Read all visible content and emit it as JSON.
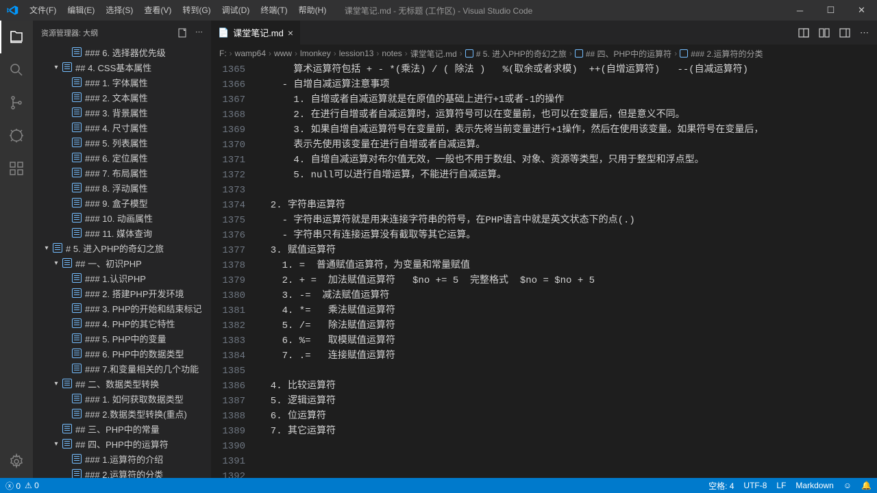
{
  "title": "课堂笔记.md - 无标题 (工作区) - Visual Studio Code",
  "menu": [
    "文件(F)",
    "编辑(E)",
    "选择(S)",
    "查看(V)",
    "转到(G)",
    "调试(D)",
    "终端(T)",
    "帮助(H)"
  ],
  "sidebar": {
    "title": "资源管理器: 大纲",
    "tree": [
      {
        "indent": 2,
        "chev": "",
        "label": "### 6. 选择器优先级"
      },
      {
        "indent": 1,
        "chev": "▾",
        "label": "## 4. CSS基本属性"
      },
      {
        "indent": 2,
        "chev": "",
        "label": "### 1. 字体属性"
      },
      {
        "indent": 2,
        "chev": "",
        "label": "### 2. 文本属性"
      },
      {
        "indent": 2,
        "chev": "",
        "label": "### 3. 背景属性"
      },
      {
        "indent": 2,
        "chev": "",
        "label": "### 4. 尺寸属性"
      },
      {
        "indent": 2,
        "chev": "",
        "label": "### 5. 列表属性"
      },
      {
        "indent": 2,
        "chev": "",
        "label": "### 6. 定位属性"
      },
      {
        "indent": 2,
        "chev": "",
        "label": "### 7. 布局属性"
      },
      {
        "indent": 2,
        "chev": "",
        "label": "### 8. 浮动属性"
      },
      {
        "indent": 2,
        "chev": "",
        "label": "### 9. 盒子模型"
      },
      {
        "indent": 2,
        "chev": "",
        "label": "### 10. 动画属性"
      },
      {
        "indent": 2,
        "chev": "",
        "label": "### 11. 媒体查询"
      },
      {
        "indent": 0,
        "chev": "▾",
        "label": "# 5. 进入PHP的奇幻之旅"
      },
      {
        "indent": 1,
        "chev": "▾",
        "label": "## 一、初识PHP"
      },
      {
        "indent": 2,
        "chev": "",
        "label": "### 1.认识PHP"
      },
      {
        "indent": 2,
        "chev": "",
        "label": "### 2. 搭建PHP开发环境"
      },
      {
        "indent": 2,
        "chev": "",
        "label": "### 3. PHP的开始和结束标记"
      },
      {
        "indent": 2,
        "chev": "",
        "label": "### 4. PHP的其它特性"
      },
      {
        "indent": 2,
        "chev": "",
        "label": "### 5. PHP中的变量"
      },
      {
        "indent": 2,
        "chev": "",
        "label": "### 6. PHP中的数据类型"
      },
      {
        "indent": 2,
        "chev": "",
        "label": "### 7.和变量相关的几个功能"
      },
      {
        "indent": 1,
        "chev": "▾",
        "label": "## 二、数据类型转换"
      },
      {
        "indent": 2,
        "chev": "",
        "label": "### 1. 如何获取数据类型"
      },
      {
        "indent": 2,
        "chev": "",
        "label": "### 2.数据类型转换(重点)"
      },
      {
        "indent": 1,
        "chev": "",
        "label": "## 三、PHP中的常量"
      },
      {
        "indent": 1,
        "chev": "▾",
        "label": "## 四、PHP中的运算符"
      },
      {
        "indent": 2,
        "chev": "",
        "label": "### 1.运算符的介绍"
      },
      {
        "indent": 2,
        "chev": "",
        "label": "### 2.运算符的分类"
      }
    ]
  },
  "tab": {
    "name": "课堂笔记.md"
  },
  "breadcrumbs": [
    "F:",
    "wamp64",
    "www",
    "lmonkey",
    "lession13",
    "notes",
    "课堂笔记.md",
    "# 5. 进入PHP的奇幻之旅",
    "## 四、PHP中的运算符",
    "### 2.运算符的分类"
  ],
  "code": {
    "start": 1365,
    "lines": [
      "      算术运算符包括 + - *(乘法) / ( 除法 )   %(取余或者求模)  ++(自增运算符)   --(自减运算符)",
      "    - 自增自减运算注意事项",
      "      1. 自增或者自减运算就是在原值的基础上进行+1或者-1的操作",
      "      2. 在进行自增或者自减运算时，运算符号可以在变量前，也可以在变量后，但是意义不同。",
      "      3. 如果自增自减运算符号在变量前，表示先将当前变量进行+1操作，然后在使用该变量。如果符号在变量后，",
      "      表示先使用该变量在进行自增或者自减运算。",
      "      4. 自增自减运算对布尔值无效，一般也不用于数组、对象、资源等类型，只用于整型和浮点型。",
      "      5. null可以进行自增运算，不能进行自减运算。",
      "",
      "  2. 字符串运算符",
      "    - 字符串运算符就是用来连接字符串的符号，在PHP语言中就是英文状态下的点(.)",
      "    - 字符串只有连接运算没有截取等其它运算。",
      "  3. 赋值运算符",
      "    1. =  普通赋值运算符，为变量和常量赋值",
      "    2. + =  加法赋值运算符   $no += 5  完整格式  $no = $no + 5",
      "    3. -=  减法赋值运算符",
      "    4. *=   乘法赋值运算符",
      "    5. /=   除法赋值运算符",
      "    6. %=   取模赋值运算符",
      "    7. .=   连接赋值运算符",
      "",
      "  4. 比较运算符",
      "  5. 逻辑运算符",
      "  6. 位运算符",
      "  7. 其它运算符",
      "",
      "",
      ""
    ]
  },
  "status": {
    "errors": "0",
    "warnings": "0",
    "spaces": "空格: 4",
    "encoding": "UTF-8",
    "eol": "LF",
    "lang": "Markdown"
  }
}
